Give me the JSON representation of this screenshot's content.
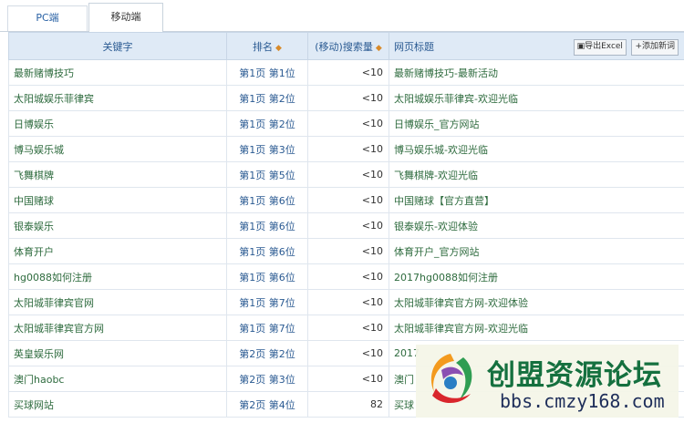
{
  "tabs": [
    {
      "label": "PC端"
    },
    {
      "label": "移动端"
    }
  ],
  "table": {
    "headers": {
      "keyword": "关键字",
      "rank": "排名",
      "volume": "(移动)搜索量",
      "title": "网页标题"
    },
    "export_label": "导出Excel",
    "add_label": "添加新词",
    "rows": [
      {
        "keyword": "最新赌博技巧",
        "rank": "第1页 第1位",
        "volume": "<10",
        "title": "最新赌博技巧-最新活动"
      },
      {
        "keyword": "太阳城娱乐菲律宾",
        "rank": "第1页 第2位",
        "volume": "<10",
        "title": "太阳城娱乐菲律宾-欢迎光临"
      },
      {
        "keyword": "日博娱乐",
        "rank": "第1页 第2位",
        "volume": "<10",
        "title": "日博娱乐_官方网站"
      },
      {
        "keyword": "博马娱乐城",
        "rank": "第1页 第3位",
        "volume": "<10",
        "title": "博马娱乐城-欢迎光临"
      },
      {
        "keyword": "飞舞棋牌",
        "rank": "第1页 第5位",
        "volume": "<10",
        "title": "飞舞棋牌-欢迎光临"
      },
      {
        "keyword": "中国赌球",
        "rank": "第1页 第6位",
        "volume": "<10",
        "title": "中国赌球【官方直营】"
      },
      {
        "keyword": "银泰娱乐",
        "rank": "第1页 第6位",
        "volume": "<10",
        "title": "银泰娱乐-欢迎体验"
      },
      {
        "keyword": "体育开户",
        "rank": "第1页 第6位",
        "volume": "<10",
        "title": "体育开户_官方网站"
      },
      {
        "keyword": "hg0088如何注册",
        "rank": "第1页 第6位",
        "volume": "<10",
        "title": "2017hg0088如何注册"
      },
      {
        "keyword": "太阳城菲律宾官网",
        "rank": "第1页 第7位",
        "volume": "<10",
        "title": "太阳城菲律宾官方网-欢迎体验"
      },
      {
        "keyword": "太阳城菲律宾官方网",
        "rank": "第1页 第7位",
        "volume": "<10",
        "title": "太阳城菲律宾官方网-欢迎光临"
      },
      {
        "keyword": "英皇娱乐网",
        "rank": "第2页 第2位",
        "volume": "<10",
        "title": "2017"
      },
      {
        "keyword": "澳门haobc",
        "rank": "第2页 第3位",
        "volume": "<10",
        "title": "澳门"
      },
      {
        "keyword": "买球网站",
        "rank": "第2页 第4位",
        "volume": "82",
        "title": "买球"
      }
    ]
  },
  "watermark": {
    "name": "创盟资源论坛",
    "url": "bbs.cmzy168.com"
  },
  "colors": {
    "header_bg": "#dfeaf6",
    "link_blue": "#2a5a92",
    "text_green": "#2e6b3e",
    "sort_orange": "#d88a2a"
  }
}
